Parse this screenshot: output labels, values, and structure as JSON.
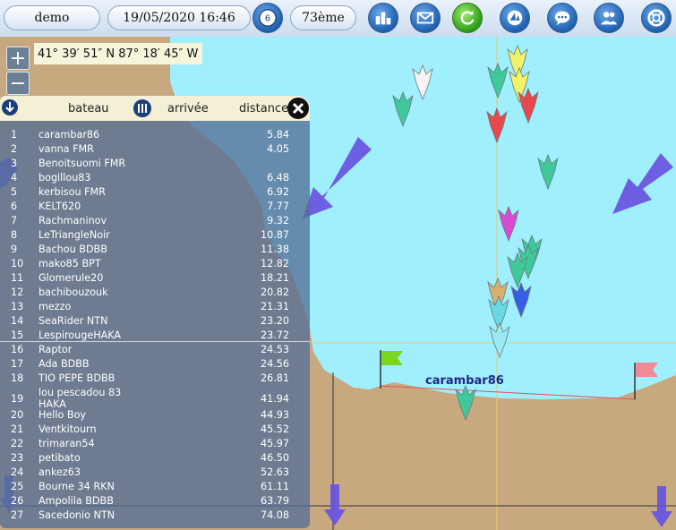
{
  "toolbar": {
    "user": "demo",
    "datetime": "19/05/2020 16:46",
    "badge_count": "6",
    "rank": "73ème",
    "icons": [
      "ranking-icon",
      "mail-icon",
      "refresh-icon",
      "logo-icon",
      "chat-icon",
      "users-icon",
      "help-icon"
    ]
  },
  "map": {
    "coords": "41° 39′ 51″ N 87° 18′ 45″ W",
    "zoom_in": "+",
    "zoom_out": "−",
    "boat_label": "carambar86",
    "colors": {
      "sea": "#9fefff",
      "land": "#c8a97f"
    }
  },
  "panel": {
    "headers": {
      "boat": "bateau",
      "arrival": "arrivée",
      "distance": "distance"
    },
    "rows": [
      {
        "rank": "1",
        "name": "carambar86",
        "dist": "5.84"
      },
      {
        "rank": "2",
        "name": "vanna FMR",
        "dist": "4.05"
      },
      {
        "rank": "3",
        "name": "Benoitsuomi FMR",
        "dist": ""
      },
      {
        "rank": "4",
        "name": "bogillou83",
        "dist": "6.48"
      },
      {
        "rank": "5",
        "name": "kerbisou FMR",
        "dist": "6.92"
      },
      {
        "rank": "6",
        "name": "KELT620",
        "dist": "7.77"
      },
      {
        "rank": "7",
        "name": "Rachmaninov",
        "dist": "9.32"
      },
      {
        "rank": "8",
        "name": "LeTriangleNoir",
        "dist": "10.87"
      },
      {
        "rank": "9",
        "name": "Bachou BDBB",
        "dist": "11.38"
      },
      {
        "rank": "10",
        "name": "mako85 BPT",
        "dist": "12.82"
      },
      {
        "rank": "11",
        "name": "Glomerule20",
        "dist": "18.21"
      },
      {
        "rank": "12",
        "name": "bachibouzouk",
        "dist": "20.82"
      },
      {
        "rank": "13",
        "name": "mezzo",
        "dist": "21.31"
      },
      {
        "rank": "14",
        "name": "SeaRider NTN",
        "dist": "23.20"
      },
      {
        "rank": "15",
        "name": "LespirougeHAKA",
        "dist": "23.72"
      },
      {
        "rank": "16",
        "name": "Raptor",
        "dist": "24.53"
      },
      {
        "rank": "17",
        "name": "Ada BDBB",
        "dist": "24.56"
      },
      {
        "rank": "18",
        "name": "TIO PEPE BDBB",
        "dist": "26.81"
      },
      {
        "rank": "19",
        "name": "lou pescadou 83 HAKA",
        "dist": "41.94"
      },
      {
        "rank": "20",
        "name": "Hello Boy",
        "dist": "44.93"
      },
      {
        "rank": "21",
        "name": "Ventkitourn",
        "dist": "45.52"
      },
      {
        "rank": "22",
        "name": "trimaran54",
        "dist": "45.97"
      },
      {
        "rank": "23",
        "name": "petibato",
        "dist": "46.50"
      },
      {
        "rank": "24",
        "name": "ankez63",
        "dist": "52.63"
      },
      {
        "rank": "25",
        "name": "Bourne 34 RKN",
        "dist": "61.11"
      },
      {
        "rank": "26",
        "name": "Ampolila BDBB",
        "dist": "63.79"
      },
      {
        "rank": "27",
        "name": "Sacedonio NTN",
        "dist": "74.08"
      }
    ]
  }
}
